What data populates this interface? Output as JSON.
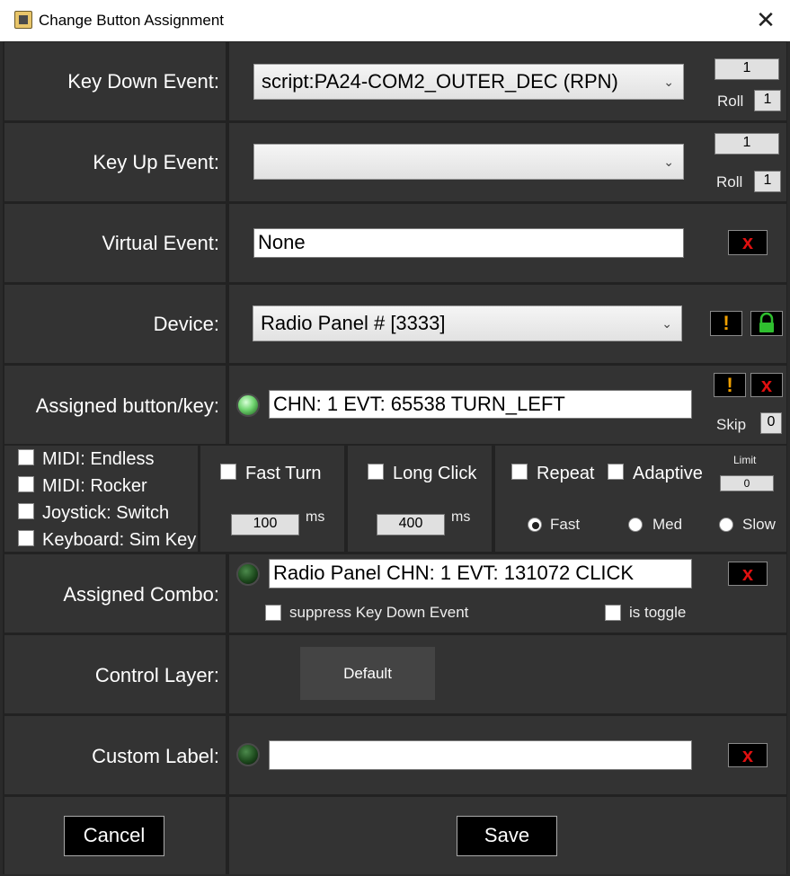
{
  "window": {
    "title": "Change Button Assignment",
    "close_glyph": "✕"
  },
  "key_down": {
    "label": "Key Down Event:",
    "value": "script:PA24-COM2_OUTER_DEC (RPN)",
    "count": "1",
    "roll_label": "Roll",
    "roll_value": "1"
  },
  "key_up": {
    "label": "Key Up Event:",
    "value": "",
    "count": "1",
    "roll_label": "Roll",
    "roll_value": "1"
  },
  "virtual": {
    "label": "Virtual Event:",
    "value": "None",
    "clear": "x"
  },
  "device": {
    "label": "Device:",
    "value": "Radio Panel # [3333]",
    "warn": "!"
  },
  "assigned": {
    "label": "Assigned button/key:",
    "value": "CHN: 1 EVT: 65538 TURN_LEFT",
    "warn": "!",
    "clear": "x",
    "skip_label": "Skip",
    "skip_value": "0"
  },
  "options": {
    "midi_endless": "MIDI: Endless",
    "midi_rocker": "MIDI: Rocker",
    "joystick_switch": "Joystick: Switch",
    "keyboard_sim": "Keyboard: Sim Key",
    "fast_turn": "Fast Turn",
    "fast_turn_ms": "100",
    "long_click": "Long Click",
    "long_click_ms": "400",
    "ms": "ms",
    "repeat": "Repeat",
    "adaptive": "Adaptive",
    "limit_label": "Limit",
    "limit_value": "0",
    "speed_fast": "Fast",
    "speed_med": "Med",
    "speed_slow": "Slow",
    "selected_speed": "Fast"
  },
  "combo": {
    "label": "Assigned Combo:",
    "value": "Radio Panel CHN: 1 EVT: 131072 CLICK",
    "clear": "x",
    "suppress": "suppress Key Down Event",
    "toggle": "is toggle"
  },
  "layer": {
    "label": "Control Layer:",
    "value": "Default"
  },
  "custom": {
    "label": "Custom Label:",
    "value": "",
    "clear": "x"
  },
  "footer": {
    "cancel": "Cancel",
    "save": "Save"
  },
  "colors": {
    "accent_red": "#e01010",
    "warn_orange": "#f0a000",
    "led_green": "#6fd46f",
    "panel": "#333333"
  }
}
